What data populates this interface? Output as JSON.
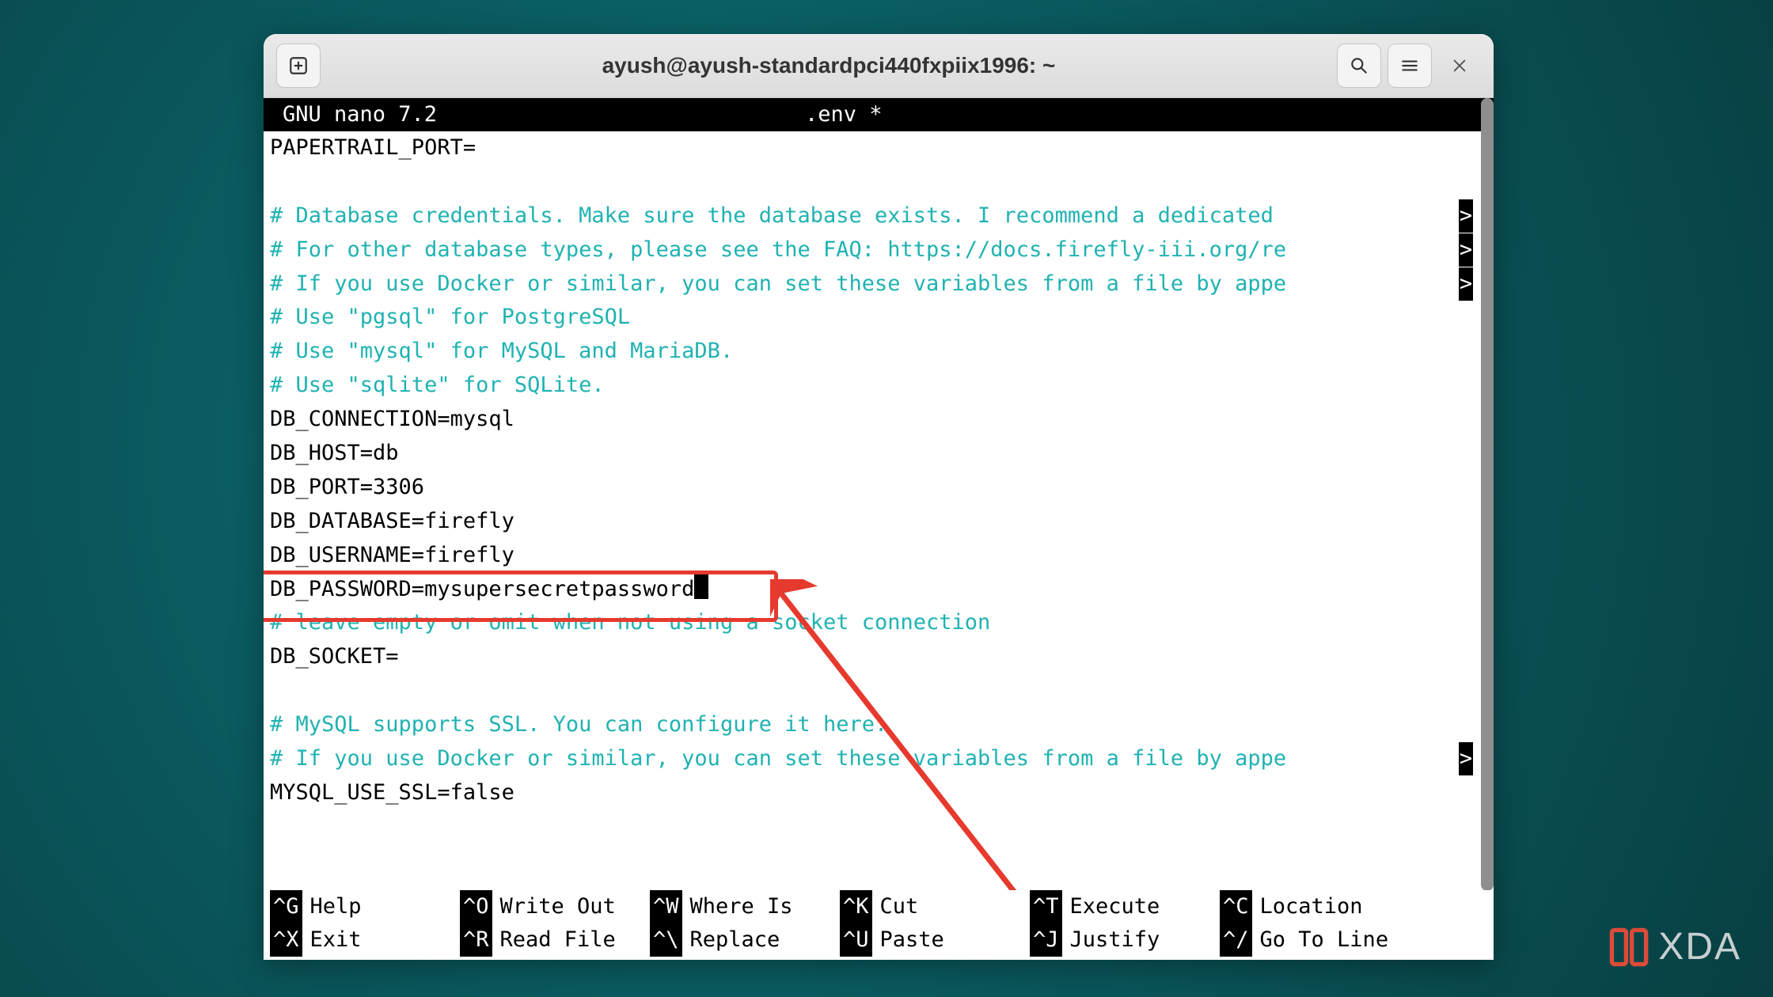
{
  "window": {
    "title": "ayush@ayush-standardpci440fxpiix1996: ~"
  },
  "nano": {
    "app": "GNU nano 7.2",
    "file": ".env *"
  },
  "lines": [
    {
      "cls": "plain",
      "text": "PAPERTRAIL_PORT="
    },
    {
      "cls": "plain",
      "text": " "
    },
    {
      "cls": "comment",
      "text": "# Database credentials. Make sure the database exists. I recommend a dedicated ",
      "ovf": ">"
    },
    {
      "cls": "comment",
      "text": "# For other database types, please see the FAQ: https://docs.firefly-iii.org/re",
      "ovf": ">"
    },
    {
      "cls": "comment",
      "text": "# If you use Docker or similar, you can set these variables from a file by appe",
      "ovf": ">"
    },
    {
      "cls": "comment",
      "text": "# Use \"pgsql\" for PostgreSQL"
    },
    {
      "cls": "comment",
      "text": "# Use \"mysql\" for MySQL and MariaDB."
    },
    {
      "cls": "comment",
      "text": "# Use \"sqlite\" for SQLite."
    },
    {
      "cls": "plain",
      "text": "DB_CONNECTION=mysql"
    },
    {
      "cls": "plain",
      "text": "DB_HOST=db"
    },
    {
      "cls": "plain",
      "text": "DB_PORT=3306"
    },
    {
      "cls": "plain",
      "text": "DB_DATABASE=firefly"
    },
    {
      "cls": "plain",
      "text": "DB_USERNAME=firefly"
    },
    {
      "cls": "plain",
      "text": "DB_PASSWORD=mysupersecretpassword",
      "cursor": true
    },
    {
      "cls": "comment",
      "text": "# leave empty or omit when not using a socket connection"
    },
    {
      "cls": "plain",
      "text": "DB_SOCKET="
    },
    {
      "cls": "plain",
      "text": " "
    },
    {
      "cls": "comment",
      "text": "# MySQL supports SSL. You can configure it here."
    },
    {
      "cls": "comment",
      "text": "# If you use Docker or similar, you can set these variables from a file by appe",
      "ovf": ">"
    },
    {
      "cls": "plain",
      "text": "MYSQL_USE_SSL=false"
    },
    {
      "cls": "plain",
      "text": " "
    }
  ],
  "shortcuts": {
    "row1": [
      {
        "key": "^G",
        "label": "Help"
      },
      {
        "key": "^O",
        "label": "Write Out"
      },
      {
        "key": "^W",
        "label": "Where Is"
      },
      {
        "key": "^K",
        "label": "Cut"
      },
      {
        "key": "^T",
        "label": "Execute"
      },
      {
        "key": "^C",
        "label": "Location"
      }
    ],
    "row2": [
      {
        "key": "^X",
        "label": "Exit"
      },
      {
        "key": "^R",
        "label": "Read File"
      },
      {
        "key": "^\\",
        "label": "Replace"
      },
      {
        "key": "^U",
        "label": "Paste"
      },
      {
        "key": "^J",
        "label": "Justify"
      },
      {
        "key": "^/",
        "label": "Go To Line"
      }
    ]
  },
  "branding": {
    "xda": "XDA"
  },
  "annotation": {
    "color": "#e63a2e"
  }
}
